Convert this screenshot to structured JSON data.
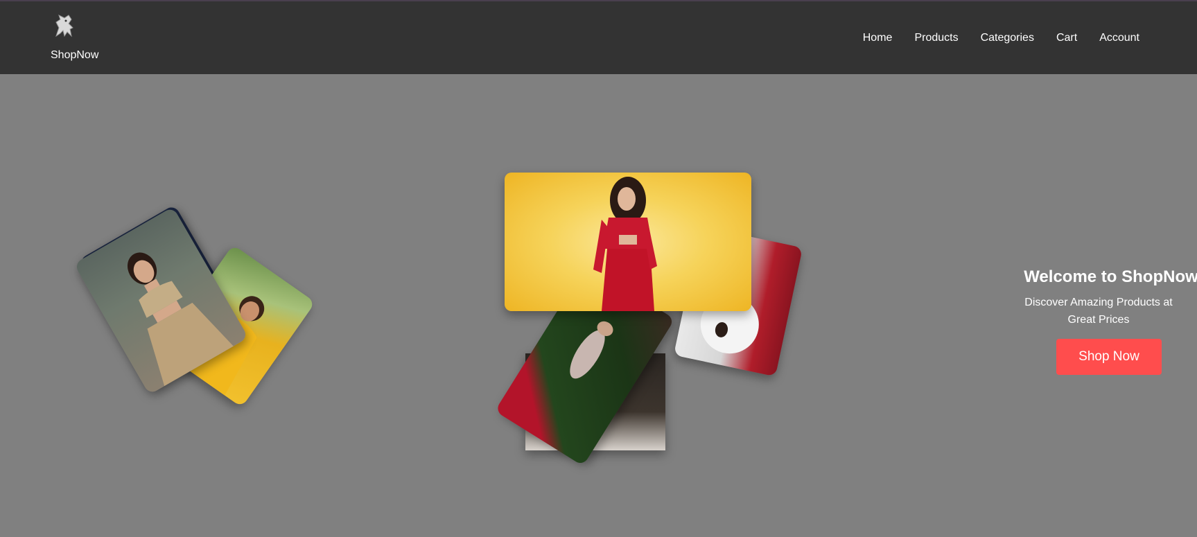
{
  "header": {
    "brand": "ShopNow",
    "logo_icon": "lion-logo-icon",
    "nav": [
      {
        "label": "Home"
      },
      {
        "label": "Products"
      },
      {
        "label": "Categories"
      },
      {
        "label": "Cart"
      },
      {
        "label": "Account"
      }
    ]
  },
  "hero": {
    "title": "Welcome to ShopNow",
    "subtitle": "Discover Amazing Products at Great Prices",
    "cta_label": "Shop Now"
  },
  "colors": {
    "header_bg": "#333333",
    "page_bg": "#808080",
    "cta_bg": "#ff4d4d",
    "text": "#ffffff"
  }
}
